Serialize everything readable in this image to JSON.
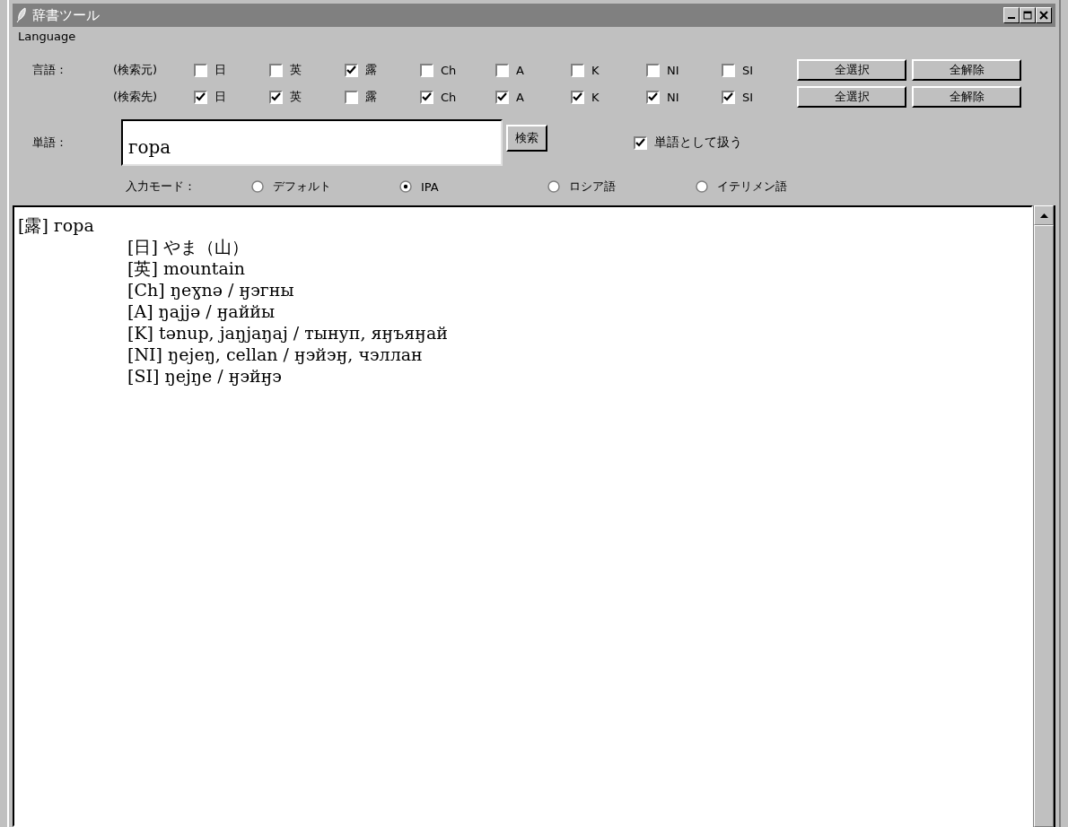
{
  "window": {
    "title": "辞書ツール"
  },
  "menu": [
    "Language"
  ],
  "languages": {
    "label": "言語：",
    "rows": [
      {
        "label": "(検索元)",
        "items": [
          {
            "label": "日",
            "checked": false
          },
          {
            "label": "英",
            "checked": false
          },
          {
            "label": "露",
            "checked": true
          },
          {
            "label": "Ch",
            "checked": false
          },
          {
            "label": "A",
            "checked": false
          },
          {
            "label": "K",
            "checked": false
          },
          {
            "label": "NI",
            "checked": false
          },
          {
            "label": "SI",
            "checked": false
          }
        ],
        "buttons": [
          "全選択",
          "全解除"
        ]
      },
      {
        "label": "(検索先)",
        "items": [
          {
            "label": "日",
            "checked": true
          },
          {
            "label": "英",
            "checked": true
          },
          {
            "label": "露",
            "checked": false
          },
          {
            "label": "Ch",
            "checked": true
          },
          {
            "label": "A",
            "checked": true
          },
          {
            "label": "K",
            "checked": true
          },
          {
            "label": "NI",
            "checked": true
          },
          {
            "label": "SI",
            "checked": true
          }
        ],
        "buttons": [
          "全選択",
          "全解除"
        ]
      }
    ]
  },
  "word": {
    "label": "単語：",
    "value": "гора",
    "search_button": "検索",
    "as_word": {
      "label": "単語として扱う",
      "checked": true
    }
  },
  "input_mode": {
    "label": "入力モード：",
    "options": [
      {
        "label": "デフォルト",
        "selected": false
      },
      {
        "label": "IPA",
        "selected": true
      },
      {
        "label": "ロシア語",
        "selected": false
      },
      {
        "label": "イテリメン語",
        "selected": false
      }
    ]
  },
  "results": [
    {
      "tag": "[露]",
      "text": "гора",
      "children": [
        {
          "tag": "[日]",
          "text": "やま（山）"
        },
        {
          "tag": "[英]",
          "text": "mountain"
        },
        {
          "tag": "[Ch]",
          "text": "ŋeɣnə / ӈэгны"
        },
        {
          "tag": "[A]",
          "text": "ŋajjə / ӈаййы"
        },
        {
          "tag": "[K]",
          "text": "tənup, jaŋjaŋaj / тынуп, яӈъяӈай"
        },
        {
          "tag": "[NI]",
          "text": "ŋejeŋ, cellan / ӈэйэӈ, чэллан"
        },
        {
          "tag": "[SI]",
          "text": "ŋejŋe / ӈэйӈэ"
        }
      ]
    }
  ]
}
